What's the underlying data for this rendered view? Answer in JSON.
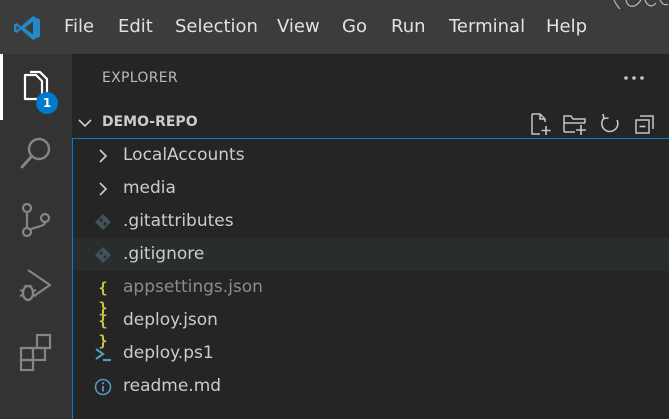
{
  "menu": {
    "items": [
      "File",
      "Edit",
      "Selection",
      "View",
      "Go",
      "Run",
      "Terminal",
      "Help"
    ]
  },
  "activity_bar": {
    "items": [
      {
        "icon": "explorer-icon",
        "active": true,
        "badge": "1"
      },
      {
        "icon": "search-icon"
      },
      {
        "icon": "source-control-icon"
      },
      {
        "icon": "run-debug-icon"
      },
      {
        "icon": "extensions-icon"
      }
    ]
  },
  "explorer": {
    "title": "EXPLORER",
    "more_icon": "ellipsis-icon",
    "section": {
      "title": "DEMO-REPO",
      "actions": [
        "new-file-icon",
        "new-folder-icon",
        "refresh-icon",
        "collapse-all-icon"
      ]
    },
    "tree": [
      {
        "label": "LocalAccounts",
        "kind": "folder",
        "icon": "chevron-right-icon"
      },
      {
        "label": "media",
        "kind": "folder",
        "icon": "chevron-right-icon"
      },
      {
        "label": ".gitattributes",
        "kind": "file",
        "icon": "git-file-icon"
      },
      {
        "label": ".gitignore",
        "kind": "file",
        "icon": "git-file-icon",
        "hovered": true
      },
      {
        "label": "appsettings.json",
        "kind": "file",
        "icon": "json-file-icon",
        "ignored": true,
        "glyph": "{ }"
      },
      {
        "label": "deploy.json",
        "kind": "file",
        "icon": "json-file-icon",
        "glyph": "{ }"
      },
      {
        "label": "deploy.ps1",
        "kind": "file",
        "icon": "powershell-file-icon"
      },
      {
        "label": "readme.md",
        "kind": "file",
        "icon": "info-file-icon"
      }
    ]
  },
  "colors": {
    "accent": "#007acc",
    "titlebar": "#3c3c3c",
    "activitybar": "#333333",
    "sidebar": "#252526",
    "json_icon": "#cbcb41",
    "powershell_icon": "#519aba"
  }
}
